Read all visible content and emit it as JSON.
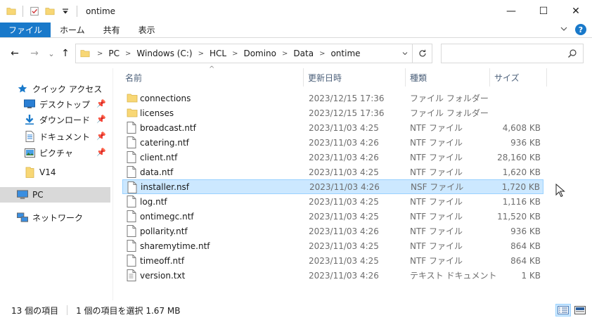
{
  "window": {
    "title": "ontime",
    "minimize": "—",
    "maximize": "☐",
    "close": "✕"
  },
  "ribbon": {
    "tabs": [
      "ファイル",
      "ホーム",
      "共有",
      "表示"
    ],
    "expand_icon": "chevron-down",
    "help": "?"
  },
  "nav": {
    "back": "←",
    "forward": "→",
    "recent": "⌄",
    "up": "↑"
  },
  "address": {
    "crumbs": [
      "PC",
      "Windows (C:)",
      "HCL",
      "Domino",
      "Data",
      "ontime"
    ]
  },
  "search": {
    "placeholder": ""
  },
  "sidebar": {
    "items": [
      {
        "label": "クイック アクセス",
        "icon": "star-icon",
        "pinned": false
      },
      {
        "label": "デスクトップ",
        "icon": "desktop-icon",
        "pinned": true
      },
      {
        "label": "ダウンロード",
        "icon": "download-icon",
        "pinned": true
      },
      {
        "label": "ドキュメント",
        "icon": "document-icon",
        "pinned": true
      },
      {
        "label": "ピクチャ",
        "icon": "picture-icon",
        "pinned": true
      },
      {
        "label": "V14",
        "icon": "folder-icon",
        "pinned": false
      },
      {
        "label": "PC",
        "icon": "pc-icon",
        "pinned": false,
        "selected": true
      },
      {
        "label": "ネットワーク",
        "icon": "network-icon",
        "pinned": false
      }
    ]
  },
  "columns": {
    "name": "名前",
    "date": "更新日時",
    "type": "種類",
    "size": "サイズ",
    "sort_indicator": "^"
  },
  "files": [
    {
      "name": "connections",
      "date": "2023/12/15 17:36",
      "type": "ファイル フォルダー",
      "size": "",
      "kind": "folder"
    },
    {
      "name": "licenses",
      "date": "2023/12/15 17:36",
      "type": "ファイル フォルダー",
      "size": "",
      "kind": "folder"
    },
    {
      "name": "broadcast.ntf",
      "date": "2023/11/03 4:25",
      "type": "NTF ファイル",
      "size": "4,608 KB",
      "kind": "file"
    },
    {
      "name": "catering.ntf",
      "date": "2023/11/03 4:26",
      "type": "NTF ファイル",
      "size": "936 KB",
      "kind": "file"
    },
    {
      "name": "client.ntf",
      "date": "2023/11/03 4:26",
      "type": "NTF ファイル",
      "size": "28,160 KB",
      "kind": "file"
    },
    {
      "name": "data.ntf",
      "date": "2023/11/03 4:25",
      "type": "NTF ファイル",
      "size": "1,620 KB",
      "kind": "file"
    },
    {
      "name": "installer.nsf",
      "date": "2023/11/03 4:26",
      "type": "NSF ファイル",
      "size": "1,720 KB",
      "kind": "file",
      "selected": true
    },
    {
      "name": "log.ntf",
      "date": "2023/11/03 4:25",
      "type": "NTF ファイル",
      "size": "1,116 KB",
      "kind": "file"
    },
    {
      "name": "ontimegc.ntf",
      "date": "2023/11/03 4:25",
      "type": "NTF ファイル",
      "size": "11,520 KB",
      "kind": "file"
    },
    {
      "name": "pollarity.ntf",
      "date": "2023/11/03 4:26",
      "type": "NTF ファイル",
      "size": "936 KB",
      "kind": "file"
    },
    {
      "name": "sharemytime.ntf",
      "date": "2023/11/03 4:25",
      "type": "NTF ファイル",
      "size": "864 KB",
      "kind": "file"
    },
    {
      "name": "timeoff.ntf",
      "date": "2023/11/03 4:25",
      "type": "NTF ファイル",
      "size": "864 KB",
      "kind": "file"
    },
    {
      "name": "version.txt",
      "date": "2023/11/03 4:26",
      "type": "テキスト ドキュメント",
      "size": "1 KB",
      "kind": "text"
    }
  ],
  "status": {
    "item_count": "13 個の項目",
    "selection": "1 個の項目を選択  1.67 MB"
  },
  "colors": {
    "accent": "#1979ca",
    "selection_bg": "#cce8ff",
    "selection_border": "#99d1ff",
    "folder": "#f8d775",
    "header_text": "#4c607a"
  }
}
